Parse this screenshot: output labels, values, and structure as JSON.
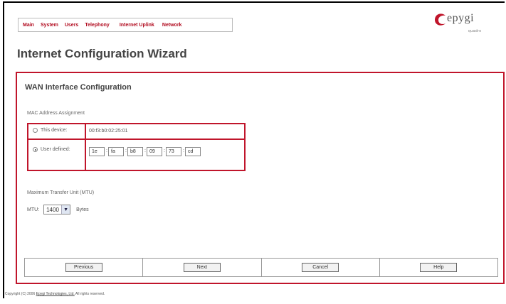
{
  "nav": {
    "items": [
      "Main",
      "System",
      "Users",
      "Telephony",
      "Internet Uplink",
      "Network"
    ]
  },
  "logo": {
    "text": "epygi",
    "subtext": "quadro"
  },
  "page": {
    "title": "Internet Configuration Wizard"
  },
  "section": {
    "title": "WAN Interface Configuration"
  },
  "mac": {
    "label": "MAC Address Assignment",
    "this_device_label": "This device:",
    "this_device_value": "00:f3:b0:02:25:01",
    "user_defined_label": "User defined:",
    "fields": [
      "1e",
      "fa",
      "b8",
      "09",
      "73",
      "cd"
    ],
    "selected": "user_defined"
  },
  "mtu": {
    "section_label": "Maximum Transfer Unit (MTU)",
    "label": "MTU:",
    "value": "1400",
    "unit": "Bytes"
  },
  "buttons": {
    "previous": "Previous",
    "next": "Next",
    "cancel": "Cancel",
    "help": "Help"
  },
  "footer": {
    "prefix": "Copyright (C) 2006",
    "company": "Epygi Technologies, Ltd.",
    "suffix": "All rights reserved."
  },
  "colors": {
    "accent": "#c0152b",
    "nav_link": "#b10a1e"
  }
}
